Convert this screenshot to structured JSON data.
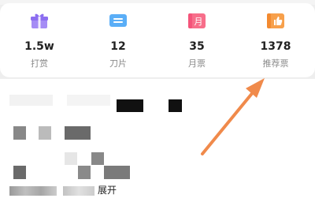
{
  "stats": [
    {
      "value": "1.5w",
      "label": "打赏",
      "icon": "gift-icon",
      "color": "#a58cf5"
    },
    {
      "value": "12",
      "label": "刀片",
      "icon": "ticket-icon",
      "color": "#5aaef7"
    },
    {
      "value": "35",
      "label": "月票",
      "icon": "calendar-icon",
      "color": "#f76e8a",
      "icon_text": "月"
    },
    {
      "value": "1378",
      "label": "推荐票",
      "icon": "thumbs-up-icon",
      "color": "#f7a04b"
    }
  ],
  "content": {
    "caption_suffix": "展开"
  },
  "colors": {
    "arrow": "#f08a4b"
  }
}
